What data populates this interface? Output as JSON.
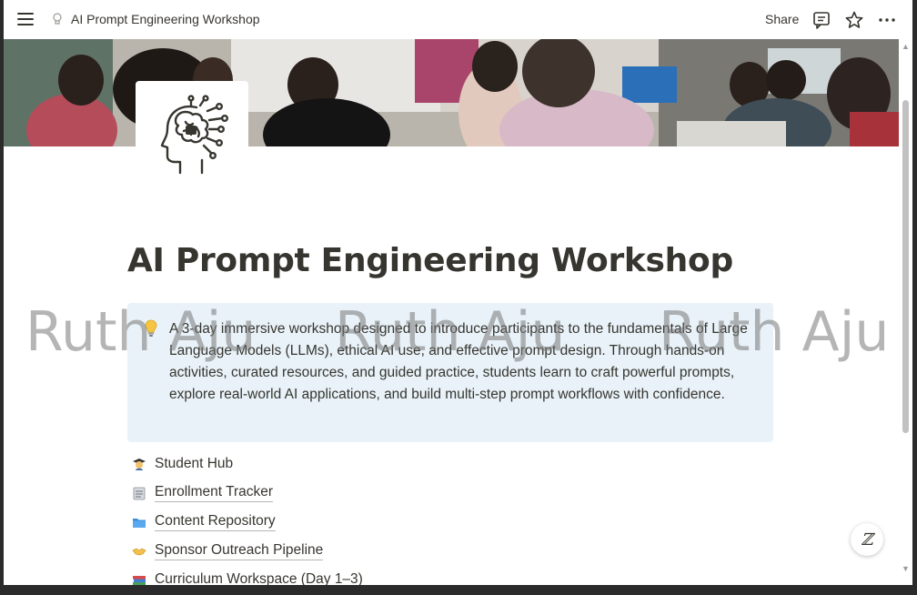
{
  "topbar": {
    "menu_icon": "hamburger-icon",
    "page_icon": "brain-circuit-icon",
    "breadcrumb_title": "AI Prompt Engineering Workshop",
    "share_label": "Share",
    "comment_icon": "comment-icon",
    "favorite_icon": "star-icon",
    "more_icon": "more-horizontal-icon"
  },
  "cover": {
    "description": "classroom photo cover"
  },
  "page": {
    "icon": "brain-circuit-icon",
    "title": "AI Prompt Engineering Workshop",
    "callout": {
      "icon": "lightbulb-icon",
      "text": "A 3-day immersive workshop designed to introduce participants to the fundamentals of Large Language Models (LLMs), ethical AI use, and effective prompt design. Through hands-on activities, curated resources, and guided practice, students learn to craft powerful prompts, explore real-world AI applications, and build multi-step prompt workflows with confidence."
    },
    "links": [
      {
        "icon": "student-icon",
        "label": "Student Hub"
      },
      {
        "icon": "notepad-icon",
        "label": "Enrollment Tracker"
      },
      {
        "icon": "folder-icon",
        "label": "Content Repository"
      },
      {
        "icon": "handshake-icon",
        "label": "Sponsor Outreach Pipeline"
      },
      {
        "icon": "books-icon",
        "label": "Curriculum Workspace (Day 1–3)"
      }
    ]
  },
  "watermark": {
    "text": "Ruth Aju"
  },
  "help_button": {
    "icon": "notion-ai-icon",
    "label": "ℤ"
  },
  "colors": {
    "text": "#37352f",
    "callout_bg": "#e8f2f8",
    "watermark": "#787878"
  }
}
